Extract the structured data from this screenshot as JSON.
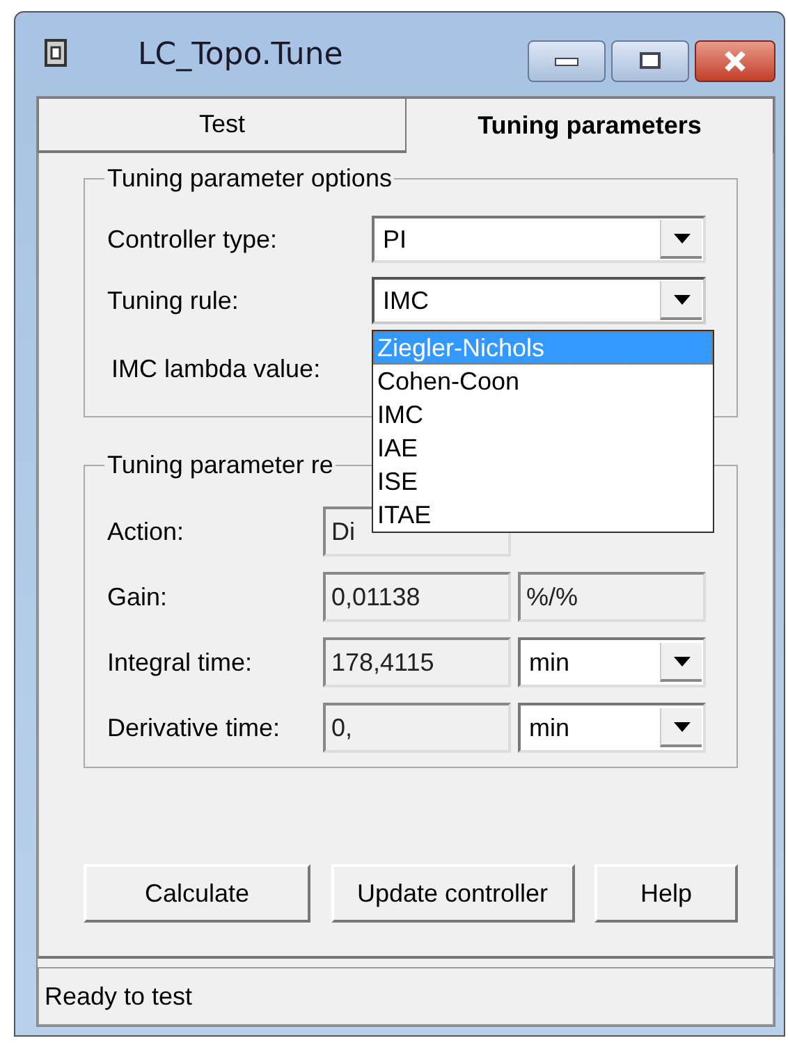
{
  "window": {
    "title": "LC_Topo.Tune"
  },
  "tabs": [
    {
      "label": "Test",
      "selected": false
    },
    {
      "label": "Tuning parameters",
      "selected": true
    }
  ],
  "options_group": {
    "title": "Tuning parameter options",
    "controller_type": {
      "label": "Controller type:",
      "value": "PI"
    },
    "tuning_rule": {
      "label": "Tuning rule:",
      "value": "IMC",
      "expanded": true,
      "options": [
        {
          "label": "Ziegler-Nichols",
          "highlighted": true
        },
        {
          "label": "Cohen-Coon",
          "highlighted": false
        },
        {
          "label": "IMC",
          "highlighted": false
        },
        {
          "label": "IAE",
          "highlighted": false
        },
        {
          "label": "ISE",
          "highlighted": false
        },
        {
          "label": "ITAE",
          "highlighted": false
        }
      ]
    },
    "lambda": {
      "label": "IMC lambda value:"
    }
  },
  "results_group": {
    "title": "Tuning parameter re",
    "rows": [
      {
        "label": "Action:",
        "value": "Di",
        "kind": "action"
      },
      {
        "label": "Gain:",
        "value": "0,01138",
        "unit": "%/%",
        "kind": "fixed"
      },
      {
        "label": "Integral time:",
        "value": "178,4115",
        "unit": "min",
        "kind": "dropdown"
      },
      {
        "label": "Derivative time:",
        "value": "0,",
        "unit": "min",
        "kind": "dropdown"
      }
    ]
  },
  "buttons": [
    "Calculate",
    "Update controller",
    "Help"
  ],
  "status_bar": "Ready to test"
}
